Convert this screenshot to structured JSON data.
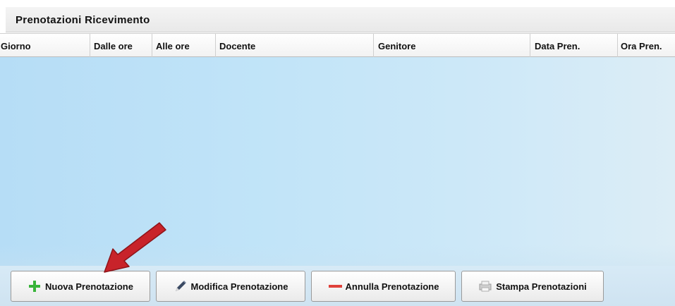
{
  "panel": {
    "title": "Prenotazioni Ricevimento"
  },
  "table": {
    "columns": [
      "Giorno",
      "Dalle ore",
      "Alle ore",
      "Docente",
      "Genitore",
      "Data Pren.",
      "Ora Pren."
    ],
    "rows": []
  },
  "toolbar": {
    "buttons": [
      {
        "label": "Nuova Prenotazione",
        "icon": "plus-icon"
      },
      {
        "label": "Modifica Prenotazione",
        "icon": "pencil-icon"
      },
      {
        "label": "Annulla Prenotazione",
        "icon": "minus-icon"
      },
      {
        "label": "Stampa Prenotazioni",
        "icon": "printer-icon"
      }
    ]
  },
  "colors": {
    "table_body": "#b6ddf6",
    "arrow": "#c8232a",
    "plus": "#39b43a",
    "minus": "#e0413b"
  }
}
